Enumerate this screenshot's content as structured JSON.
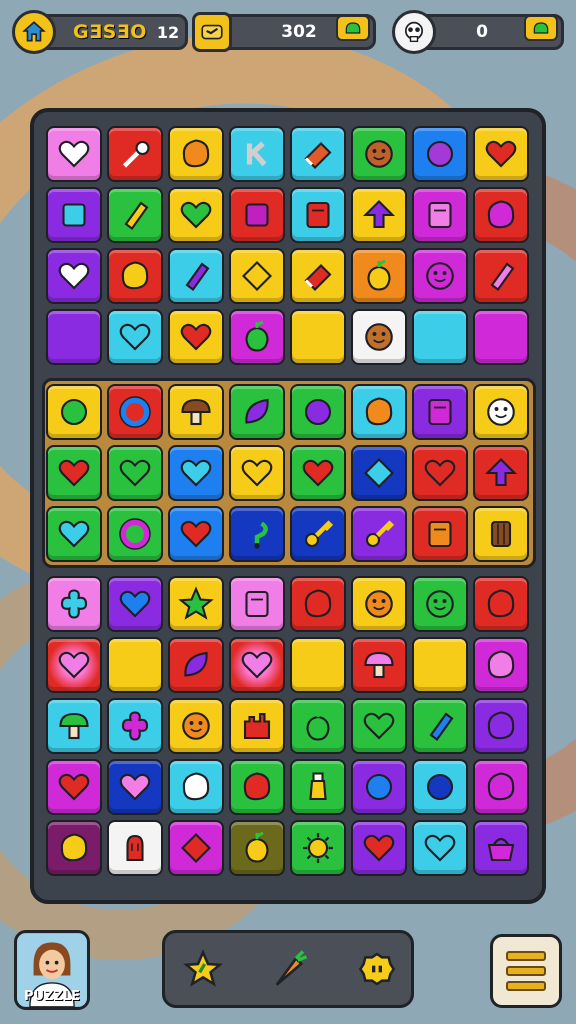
{
  "hud": {
    "level_label": "GƎSƎO",
    "level_value": "12",
    "score_value": "302",
    "lives_value": "0"
  },
  "bottom": {
    "avatar_label": "PUZZLE"
  },
  "colors": {
    "pink": "#f07ee6",
    "red": "#e02a24",
    "yellow": "#f7cc18",
    "cyan": "#3ccde8",
    "green": "#29c13e",
    "blue": "#1e7ff0",
    "purple": "#8a2be2",
    "orange": "#f08a1c",
    "white": "#f4f4f4",
    "magenta": "#d02ad8",
    "navy": "#1438c0",
    "olive": "#6b6a1c",
    "maroon": "#7a1c6a"
  },
  "board": {
    "top_rows": [
      [
        [
          "pink",
          "heart",
          "#ffffff"
        ],
        [
          "red",
          "wand",
          "#ffffff"
        ],
        [
          "yellow",
          "blob",
          "#f08a1c"
        ],
        [
          "cyan",
          "letter",
          "#cfcfcf"
        ],
        [
          "cyan",
          "eraser",
          "#e05a2a"
        ],
        [
          "green",
          "face",
          "#c0602a"
        ],
        [
          "blue",
          "circle",
          "#a23ad8"
        ],
        [
          "yellow",
          "heart",
          "#e02a24"
        ]
      ],
      [
        [
          "purple",
          "square",
          "#3ccde8"
        ],
        [
          "green",
          "stick",
          "#f7cc18"
        ],
        [
          "yellow",
          "heart",
          "#29c13e"
        ],
        [
          "red",
          "square",
          "#c020c0"
        ],
        [
          "cyan",
          "box",
          "#e02a24"
        ],
        [
          "yellow",
          "arrow",
          "#8a2be2"
        ],
        [
          "magenta",
          "box",
          "#f07ee6"
        ],
        [
          "red",
          "blob",
          "#d02ad8"
        ]
      ],
      [
        [
          "purple",
          "heart",
          "#ffffff"
        ],
        [
          "red",
          "blob",
          "#f7cc18"
        ],
        [
          "cyan",
          "stick",
          "#8a2be2"
        ],
        [
          "yellow",
          "diamond",
          "#f7cc18"
        ],
        [
          "yellow",
          "eraser",
          "#e02a24"
        ],
        [
          "orange",
          "fruit",
          "#f7cc18"
        ],
        [
          "magenta",
          "face",
          "#d02ad8"
        ],
        [
          "red",
          "stick",
          "#f07ee6"
        ]
      ],
      [
        [
          "purple",
          "none",
          ""
        ],
        [
          "cyan",
          "heart",
          "#3ccde8"
        ],
        [
          "yellow",
          "heart",
          "#e02a24"
        ],
        [
          "magenta",
          "fruit",
          "#29c13e"
        ],
        [
          "yellow",
          "none",
          ""
        ],
        [
          "white",
          "face",
          "#c0702a"
        ],
        [
          "cyan",
          "none",
          ""
        ],
        [
          "magenta",
          "none",
          ""
        ]
      ]
    ],
    "mid_rows": [
      [
        [
          "yellow",
          "circle",
          "#29c13e"
        ],
        [
          "red",
          "ring",
          "#1e7ff0"
        ],
        [
          "yellow",
          "mushroom",
          "#8a4a20"
        ],
        [
          "green",
          "leaf",
          "#8a2be2"
        ],
        [
          "green",
          "circle",
          "#8a2be2"
        ],
        [
          "cyan",
          "blob",
          "#f08a1c"
        ],
        [
          "purple",
          "box",
          "#d02ad8"
        ],
        [
          "yellow",
          "face",
          "#ffffff"
        ]
      ],
      [
        [
          "green",
          "heart",
          "#e02a24"
        ],
        [
          "green",
          "heart",
          "#29c13e"
        ],
        [
          "blue",
          "heart",
          "#3ccde8"
        ],
        [
          "yellow",
          "heart",
          "#f7cc18"
        ],
        [
          "green",
          "heart",
          "#e02a24"
        ],
        [
          "navy",
          "diamond",
          "#3ccde8"
        ],
        [
          "red",
          "heart",
          "#e02a24"
        ],
        [
          "red",
          "arrow",
          "#8a2be2"
        ]
      ],
      [
        [
          "green",
          "heart",
          "#3ccde8"
        ],
        [
          "green",
          "ring",
          "#d02ad8"
        ],
        [
          "blue",
          "heart",
          "#e02a24"
        ],
        [
          "navy",
          "hook",
          "#29c13e"
        ],
        [
          "navy",
          "key",
          "#f7cc18"
        ],
        [
          "purple",
          "key",
          "#f7cc18"
        ],
        [
          "red",
          "box",
          "#f08a1c"
        ],
        [
          "yellow",
          "barrel",
          "#8a4a20"
        ]
      ]
    ],
    "bottom_rows": [
      [
        [
          "pink",
          "flower",
          "#3ccde8"
        ],
        [
          "purple",
          "heart",
          "#1e7ff0"
        ],
        [
          "yellow",
          "star",
          "#29c13e"
        ],
        [
          "pink",
          "box",
          "#f07ee6"
        ],
        [
          "red",
          "blob",
          "#e02a24"
        ],
        [
          "yellow",
          "face",
          "#f08a1c"
        ],
        [
          "green",
          "face",
          "#29c13e"
        ],
        [
          "red",
          "blob",
          "#e02a24"
        ]
      ],
      [
        [
          "red",
          "burst",
          "#f07ee6"
        ],
        [
          "yellow",
          "none",
          ""
        ],
        [
          "red",
          "leaf",
          "#8a2be2"
        ],
        [
          "red",
          "burst",
          "#f07ee6"
        ],
        [
          "yellow",
          "none",
          ""
        ],
        [
          "red",
          "mushroom",
          "#f07ee6"
        ],
        [
          "yellow",
          "none",
          ""
        ],
        [
          "magenta",
          "blob",
          "#f07ee6"
        ]
      ],
      [
        [
          "cyan",
          "mushroom",
          "#29c13e"
        ],
        [
          "cyan",
          "flower",
          "#d02ad8"
        ],
        [
          "yellow",
          "face",
          "#f08a1c"
        ],
        [
          "yellow",
          "castle",
          "#e02a24"
        ],
        [
          "green",
          "fruit",
          "#29c13e"
        ],
        [
          "green",
          "heart",
          "#29c13e"
        ],
        [
          "green",
          "stick",
          "#1e7ff0"
        ],
        [
          "purple",
          "blob",
          "#8a2be2"
        ]
      ],
      [
        [
          "magenta",
          "heart",
          "#e02a24"
        ],
        [
          "navy",
          "heart",
          "#f07ee6"
        ],
        [
          "cyan",
          "blob",
          "#ffffff"
        ],
        [
          "green",
          "blob",
          "#e02a24"
        ],
        [
          "green",
          "bottle",
          "#f7cc18"
        ],
        [
          "purple",
          "circle",
          "#1e7ff0"
        ],
        [
          "cyan",
          "circle",
          "#1438c0"
        ],
        [
          "magenta",
          "blob",
          "#d02ad8"
        ]
      ],
      [
        [
          "maroon",
          "blob",
          "#f7cc18"
        ],
        [
          "white",
          "glove",
          "#e02a24"
        ],
        [
          "magenta",
          "diamond",
          "#e02a24"
        ],
        [
          "olive",
          "fruit",
          "#f7cc18"
        ],
        [
          "green",
          "sun",
          "#f7cc18"
        ],
        [
          "purple",
          "heart",
          "#e02a24"
        ],
        [
          "cyan",
          "heart",
          "#3ccde8"
        ],
        [
          "purple",
          "basket",
          "#d02ad8"
        ]
      ]
    ]
  }
}
